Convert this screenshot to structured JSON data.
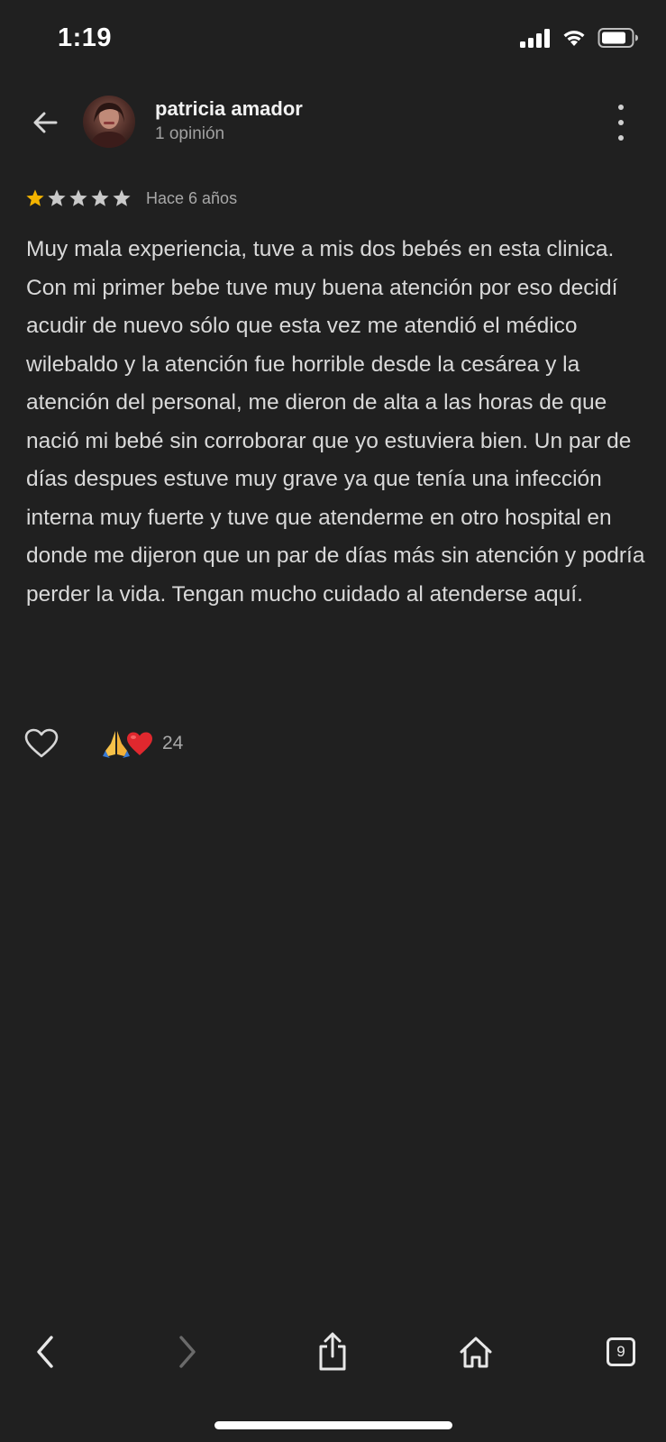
{
  "status_bar": {
    "time": "1:19"
  },
  "header": {
    "author_name": "patricia amador",
    "author_reviews": "1 opinión"
  },
  "review": {
    "rating": 1,
    "max_rating": 5,
    "time_ago": "Hace 6 años",
    "text": "Muy mala experiencia, tuve a mis dos bebés en esta clinica. Con mi primer bebe tuve muy buena atención por eso decidí acudir de nuevo sólo que esta vez me atendió el médico wilebaldo y la atención fue horrible desde la cesárea y la atención del personal, me dieron de alta a las horas de que nació mi bebé sin corroborar que yo estuviera bien. Un par de días despues estuve muy grave ya que tenía una infección interna muy fuerte y tuve que atenderme en otro hospital en donde me dijeron que un par de días más sin atención y podría perder la vida. Tengan mucho cuidado al atenderse aquí.",
    "reaction_count": "24"
  },
  "toolbar": {
    "tabs_count": "9"
  },
  "colors": {
    "background": "#202020",
    "star_filled": "#f4b400",
    "star_empty": "#c9c9c9",
    "text": "#d9d9d9",
    "muted": "#a8a8a8"
  },
  "icons": {
    "back": "arrow-left-icon",
    "more": "more-vert-icon",
    "like": "heart-outline-icon",
    "reaction_1": "folded-hands-emoji",
    "reaction_2": "red-heart-emoji",
    "nav_back": "chevron-left-icon",
    "nav_forward": "chevron-right-icon",
    "share": "share-icon",
    "home": "home-icon",
    "tabs": "tabs-icon"
  }
}
